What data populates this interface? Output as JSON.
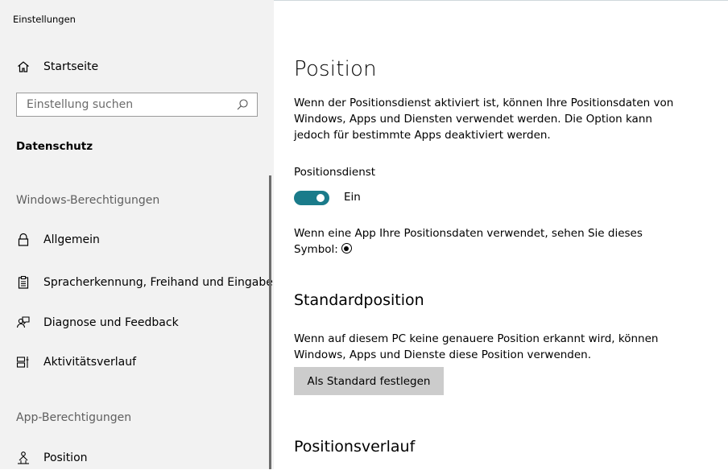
{
  "window": {
    "title": "Einstellungen"
  },
  "sidebar": {
    "home_label": "Startseite",
    "search_placeholder": "Einstellung suchen",
    "category": "Datenschutz",
    "windows_permissions_header": "Windows-Berechtigungen",
    "items": [
      {
        "label": "Allgemein",
        "icon": "lock-icon"
      },
      {
        "label": "Spracherkennung, Freihand und Eingabe",
        "icon": "clipboard-icon"
      },
      {
        "label": "Diagnose und Feedback",
        "icon": "feedback-person-icon"
      },
      {
        "label": "Aktivitätsverlauf",
        "icon": "timeline-icon"
      }
    ],
    "app_permissions_header": "App-Berechtigungen",
    "app_items": [
      {
        "label": "Position",
        "icon": "location-person-icon"
      }
    ]
  },
  "main": {
    "title": "Position",
    "intro": "Wenn der Positionsdienst aktiviert ist, können Ihre Positionsdaten von Windows, Apps und Diensten verwendet werden. Die Option kann jedoch für bestimmte Apps deaktiviert werden.",
    "service_label": "Positionsdienst",
    "toggle": {
      "on": true,
      "state_label": "Ein"
    },
    "symbol_text": "Wenn eine App Ihre Positionsdaten verwendet, sehen Sie dieses Symbol:",
    "default_section": {
      "title": "Standardposition",
      "text": "Wenn auf diesem PC keine genauere Position erkannt wird, können Windows, Apps und Dienste diese Position verwenden.",
      "button_label": "Als Standard festlegen"
    },
    "history_section": {
      "title": "Positionsverlauf"
    }
  },
  "colors": {
    "accent": "#1a7b8a",
    "sidebar_bg": "#f2f2f2",
    "button_bg": "#cccccc"
  }
}
